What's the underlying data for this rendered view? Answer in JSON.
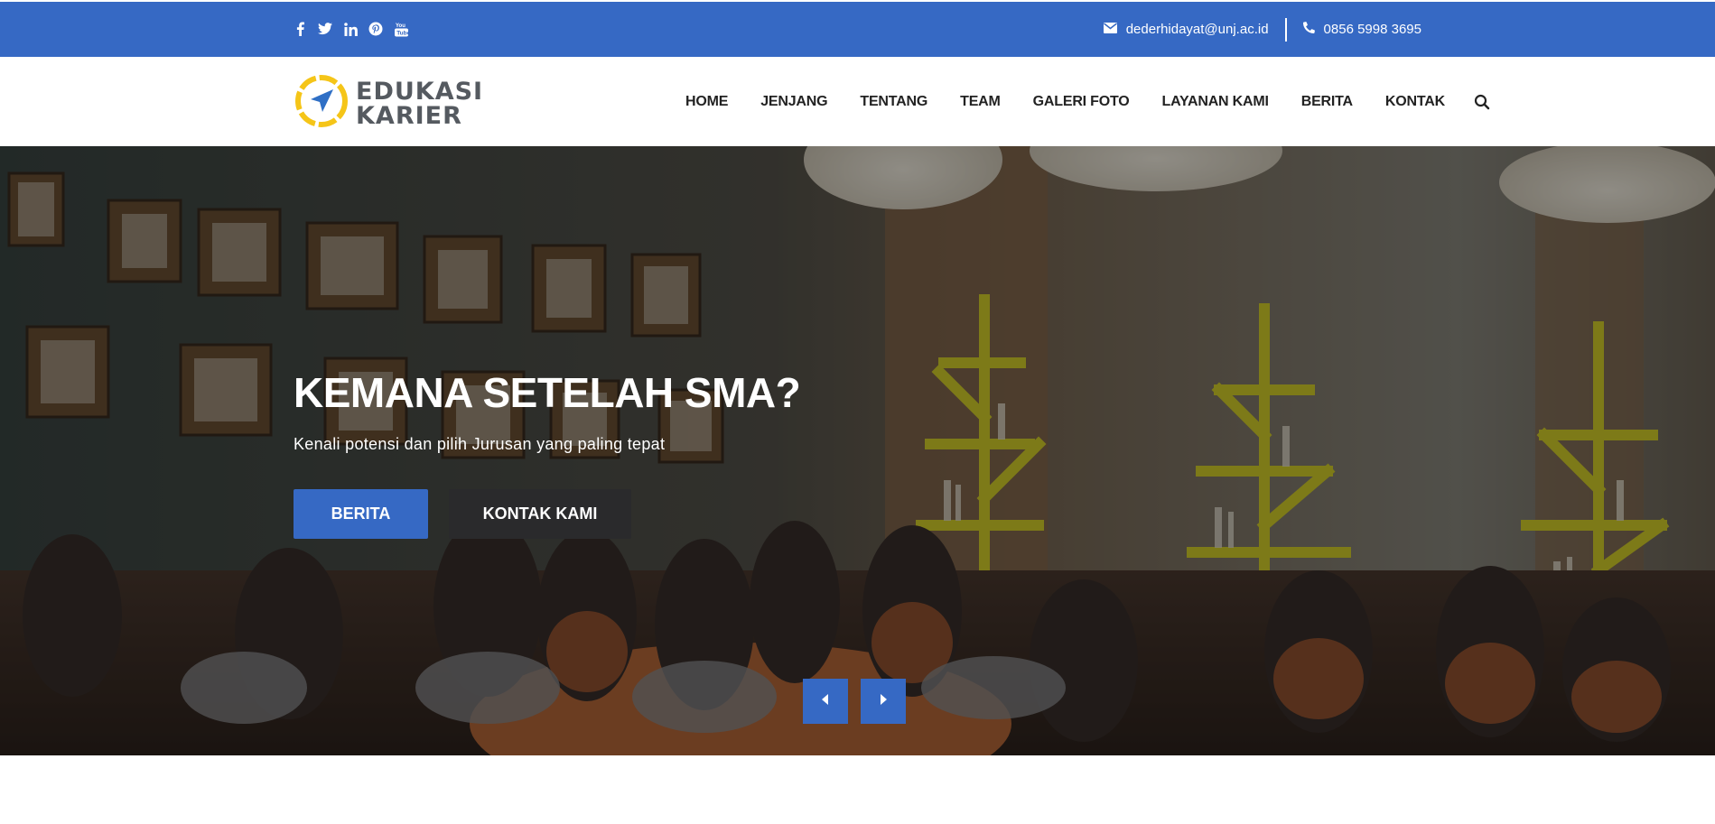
{
  "topbar": {
    "social_icons": [
      "facebook-icon",
      "twitter-icon",
      "linkedin-icon",
      "pinterest-icon",
      "youtube-icon"
    ],
    "email": "dederhidayat@unj.ac.id",
    "phone": "0856 5998 3695",
    "background_color": "#3669c4"
  },
  "logo": {
    "line1": "EDUKASI",
    "line2": "KARIER",
    "ring_color": "#f5c518",
    "arrow_color": "#2f6fc5"
  },
  "nav": {
    "items": [
      "HOME",
      "JENJANG",
      "TENTANG",
      "TEAM",
      "GALERI FOTO",
      "LAYANAN KAMI",
      "BERITA",
      "KONTAK"
    ]
  },
  "hero": {
    "title": "KEMANA SETELAH SMA?",
    "subtitle": "Kenali potensi dan pilih Jurusan yang paling tepat",
    "primary_button": "BERITA",
    "secondary_button": "KONTAK KAMI",
    "accent_color": "#3669c4"
  }
}
